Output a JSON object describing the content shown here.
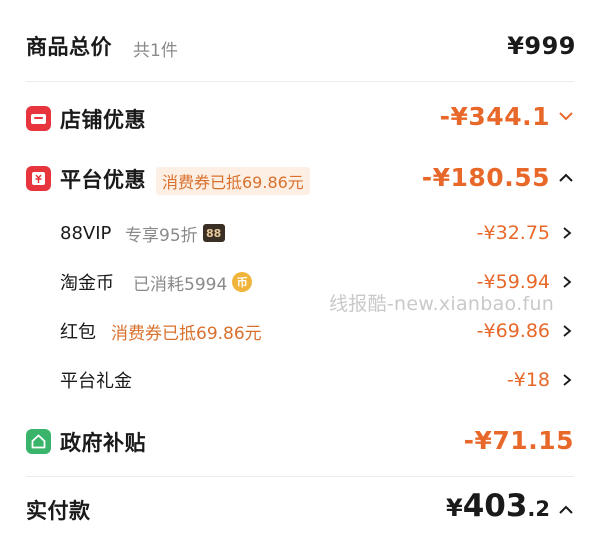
{
  "summary": {
    "title": "商品总价",
    "count": "共1件",
    "price": "¥999"
  },
  "store_discount": {
    "label": "店铺优惠",
    "amount": "-¥344.1",
    "icon": "store-icon"
  },
  "platform_discount": {
    "label": "平台优惠",
    "tag": "消费券已抵69.86元",
    "amount": "-¥180.55",
    "icon": "coupon-icon"
  },
  "sub_items": [
    {
      "label": "88VIP",
      "note": "专享95折",
      "badge": "88",
      "amount": "-¥32.75"
    },
    {
      "label": "淘金币",
      "note": "已消耗5994",
      "badge": "币",
      "amount": "-¥59.94"
    },
    {
      "label": "红包",
      "note": "消费券已抵69.86元",
      "amount": "-¥69.86"
    },
    {
      "label": "平台礼金",
      "amount": "-¥18"
    }
  ],
  "gov_subsidy": {
    "label": "政府补贴",
    "amount": "-¥71.15",
    "icon": "house-icon"
  },
  "payment": {
    "label": "实付款",
    "currency": "¥",
    "integer": "403",
    "decimal": ".2"
  },
  "watermark": "线报酷-new.xianbao.fun",
  "colors": {
    "accent": "#e8682a",
    "store_icon": "#e8353d",
    "platform_icon": "#e8353d",
    "gov_icon": "#3ab46a"
  }
}
